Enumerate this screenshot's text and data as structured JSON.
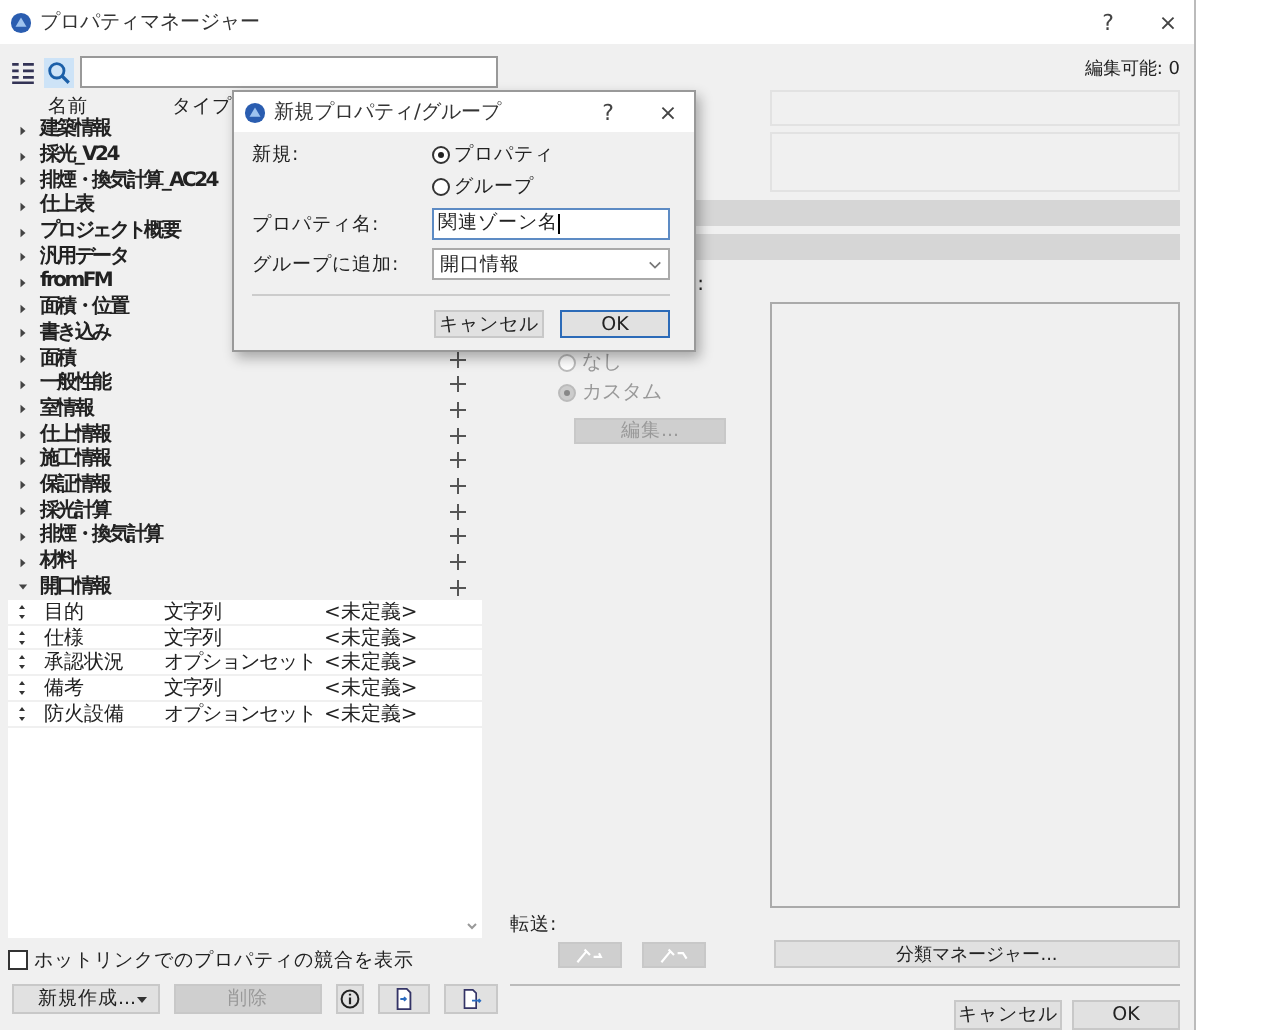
{
  "window": {
    "title": "プロパティマネージャー",
    "help": "?",
    "close": "×"
  },
  "tree": {
    "columns": [
      "名前",
      "タイプ"
    ],
    "groups": [
      {
        "name": "建築情報",
        "expanded": false,
        "add_button": false
      },
      {
        "name": "採光_V24",
        "expanded": false,
        "add_button": false
      },
      {
        "name": "排煙・換気計算_AC24",
        "expanded": false,
        "add_button": false
      },
      {
        "name": "仕上表",
        "expanded": false,
        "add_button": false
      },
      {
        "name": "プロジェクト概要",
        "expanded": false,
        "add_button": false
      },
      {
        "name": "汎用データ",
        "expanded": false,
        "add_button": false
      },
      {
        "name": "fromFM",
        "expanded": false,
        "add_button": false
      },
      {
        "name": "面積・位置",
        "expanded": false,
        "add_button": false
      },
      {
        "name": "書き込み",
        "expanded": false,
        "add_button": false
      },
      {
        "name": "面積",
        "expanded": false,
        "add_button": true
      },
      {
        "name": "一般性能",
        "expanded": false,
        "add_button": true
      },
      {
        "name": "室情報",
        "expanded": false,
        "add_button": true
      },
      {
        "name": "仕上情報",
        "expanded": false,
        "add_button": true
      },
      {
        "name": "施工情報",
        "expanded": false,
        "add_button": true
      },
      {
        "name": "保証情報",
        "expanded": false,
        "add_button": true
      },
      {
        "name": "採光計算",
        "expanded": false,
        "add_button": true
      },
      {
        "name": "排煙・換気計算",
        "expanded": false,
        "add_button": true
      },
      {
        "name": "材料",
        "expanded": false,
        "add_button": true
      },
      {
        "name": "開口情報",
        "expanded": true,
        "add_button": true,
        "children": [
          {
            "name": "目的",
            "type": "文字列",
            "value": "<未定義>"
          },
          {
            "name": "仕様",
            "type": "文字列",
            "value": "<未定義>"
          },
          {
            "name": "承認状況",
            "type": "オプションセット",
            "value": "<未定義>"
          },
          {
            "name": "備考",
            "type": "文字列",
            "value": "<未定義>"
          },
          {
            "name": "防火設備",
            "type": "オプションセット",
            "value": "<未定義>"
          }
        ]
      }
    ]
  },
  "hotlink_checkbox": {
    "label": "ホットリンクでのプロパティの競合を表示",
    "checked": false
  },
  "new_button": "新規作成...",
  "delete_button": {
    "label": "削除",
    "disabled": true
  },
  "right": {
    "editable": "編集可能: 0",
    "colon": ":",
    "radios": [
      {
        "label": "なし",
        "selected": false
      },
      {
        "label": "カスタム",
        "selected": true
      }
    ],
    "edit_button": {
      "label": "編集...",
      "disabled": true
    },
    "transfer_label": "転送:",
    "classification_button": "分類マネージャー..."
  },
  "buttons": [
    "キャンセル",
    "OK"
  ],
  "dialog": {
    "title": "新規プロパティ/グループ",
    "help": "?",
    "close": "×",
    "new_label": "新規:",
    "radios": [
      {
        "label": "プロパティ",
        "selected": true
      },
      {
        "label": "グループ",
        "selected": false
      }
    ],
    "name_label": "プロパティ名:",
    "name_value": "関連ゾーン名",
    "group_label": "グループに追加:",
    "group_value": "開口情報",
    "buttons": [
      "キャンセル",
      "OK"
    ]
  }
}
